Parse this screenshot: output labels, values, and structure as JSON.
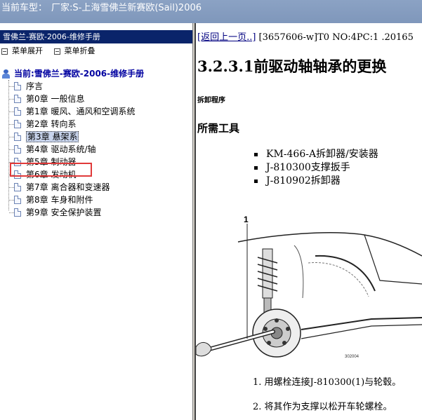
{
  "titlebar": {
    "label": "当前车型：",
    "vehicle": "厂家:S-上海雪佛兰新赛欧(Sail)2006"
  },
  "left_panel": {
    "header": "雪佛兰-赛欧-2006-维修手册",
    "expand_all": "菜单展开",
    "collapse_all": "菜单折叠",
    "root": "当前:雪佛兰-赛欧-2006-维修手册",
    "items": [
      "序言",
      "第0章 一般信息",
      "第1章 暖风、通风和空调系统",
      "第2章 转向系",
      "第3章 悬架系",
      "第4章 驱动系统/轴",
      "第5章 制动器",
      "第6章 发动机",
      "第7章 离合器和变速器",
      "第8章 车身和附件",
      "第9章 安全保护装置"
    ],
    "selected_index": 4,
    "highlight_color": "#e03a3a"
  },
  "content": {
    "back_link": "[返回上一页..]",
    "nav_info": " [3657606-w]T0 NO:4PC:1 .20165",
    "title": "3.2.3.1前驱动轴轴承的更换",
    "procedure_label": "拆卸程序",
    "tools_heading": "所需工具",
    "tools": [
      "KM-466-A拆卸器/安装器",
      "J-810300支撑扳手",
      "J-810902拆卸器"
    ],
    "figure_callout": "1",
    "figure_code": "302004",
    "steps": [
      "1. 用螺栓连接J-810300(1)与轮毂。",
      "2. 将其作为支撑以松开车轮螺栓。"
    ]
  }
}
